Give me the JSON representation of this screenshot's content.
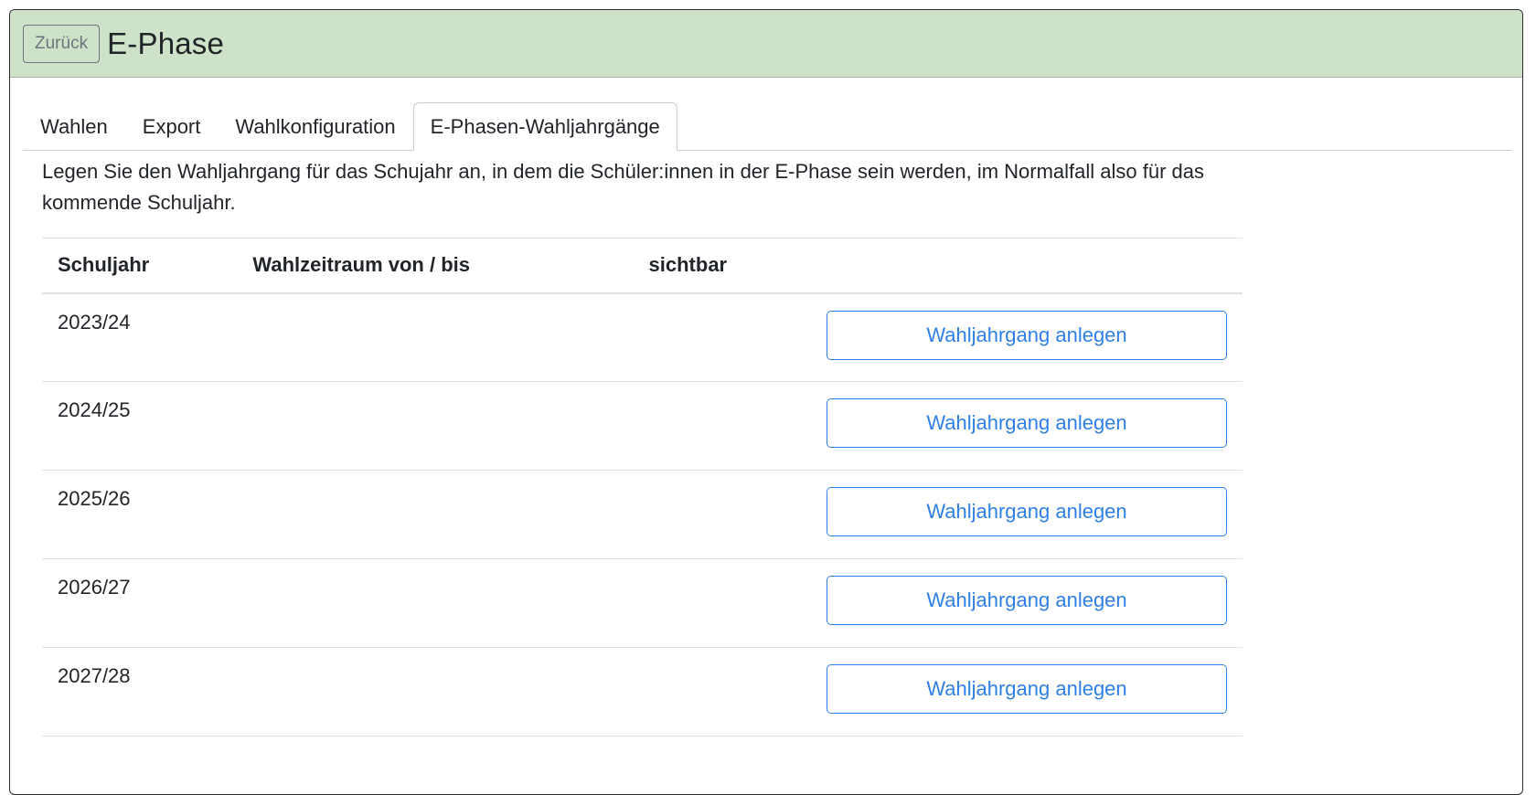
{
  "header": {
    "back_label": "Zurück",
    "title": "E-Phase",
    "background_color": "#cde2c8"
  },
  "tabs": [
    {
      "label": "Wahlen",
      "active": false
    },
    {
      "label": "Export",
      "active": false
    },
    {
      "label": "Wahlkonfiguration",
      "active": false
    },
    {
      "label": "E-Phasen-Wahljahrgänge",
      "active": true
    }
  ],
  "intro_text": "Legen Sie den Wahljahrgang für das Schujahr an, in dem die Schüler:innen in der E-Phase sein werden, im Normalfall also für das kommende Schuljahr.",
  "table": {
    "columns": [
      "Schuljahr",
      "Wahlzeitraum von / bis",
      "sichtbar",
      ""
    ],
    "rows": [
      {
        "schuljahr": "2023/24",
        "wahlzeitraum": "",
        "sichtbar": "",
        "action_label": "Wahljahrgang anlegen"
      },
      {
        "schuljahr": "2024/25",
        "wahlzeitraum": "",
        "sichtbar": "",
        "action_label": "Wahljahrgang anlegen"
      },
      {
        "schuljahr": "2025/26",
        "wahlzeitraum": "",
        "sichtbar": "",
        "action_label": "Wahljahrgang anlegen"
      },
      {
        "schuljahr": "2026/27",
        "wahlzeitraum": "",
        "sichtbar": "",
        "action_label": "Wahljahrgang anlegen"
      },
      {
        "schuljahr": "2027/28",
        "wahlzeitraum": "",
        "sichtbar": "",
        "action_label": "Wahljahrgang anlegen"
      }
    ]
  },
  "colors": {
    "accent": "#2f7fe6",
    "text": "#212529",
    "muted": "#6c757d"
  }
}
